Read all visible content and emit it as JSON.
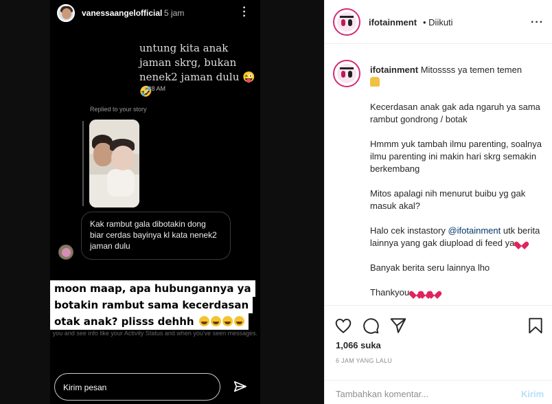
{
  "story": {
    "username": "vanessaangelofficial",
    "time": "5 jam",
    "dm_message": "untung kita anak jaman skrg, bukan nenek2 jaman dulu 😜🤣",
    "dm_time": "9:38 AM",
    "replied_label": "Replied to your story",
    "comment": "Kak rambut gala dibotakin dong biar cerdas bayinya kl kata nenek2 jaman dulu",
    "overlay_lines": [
      "moon maap, apa hubungannya ya",
      "botakin rambut sama kecerdasan",
      "otak anak? plisss dehhh"
    ],
    "under_text": "you and see info like your Activity Status and when you've seen messages.",
    "message_placeholder": "Kirim pesan"
  },
  "post": {
    "account": "ifotainment",
    "follow_status": "• Diikuti",
    "caption_lead": "Mitossss ya temen temen",
    "caption_paragraphs": [
      "Kecerdasan anak gak ada ngaruh ya sama rambut gondrong / botak",
      "Hmmm yuk tambah ilmu parenting, soalnya ilmu parenting ini makin hari skrg semakin berkembang",
      "Mitos apalagi nih menurut buibu yg gak masuk akal?"
    ],
    "caption_mention_pre": "Halo cek instastory",
    "caption_mention": "@ifotainment",
    "caption_mention_post": "utk berita lainnya yang gak diupload di feed ya",
    "caption_more": "Banyak berita seru lainnya lho",
    "caption_thanks": "Thankyou",
    "likes": "1,066 suka",
    "time_ago": "6 JAM YANG LALU",
    "comment_placeholder": "Tambahkan komentar...",
    "post_label": "Kirim"
  },
  "icons": [
    "more-icon",
    "send-icon",
    "heart-icon",
    "comment-icon",
    "share-icon",
    "save-icon",
    "pray-emoji",
    "heart-emoji"
  ],
  "colors": {
    "link": "#00376b",
    "post_button": "#b2dffc",
    "story_bg": "#000000",
    "heart": "#e0245e"
  }
}
